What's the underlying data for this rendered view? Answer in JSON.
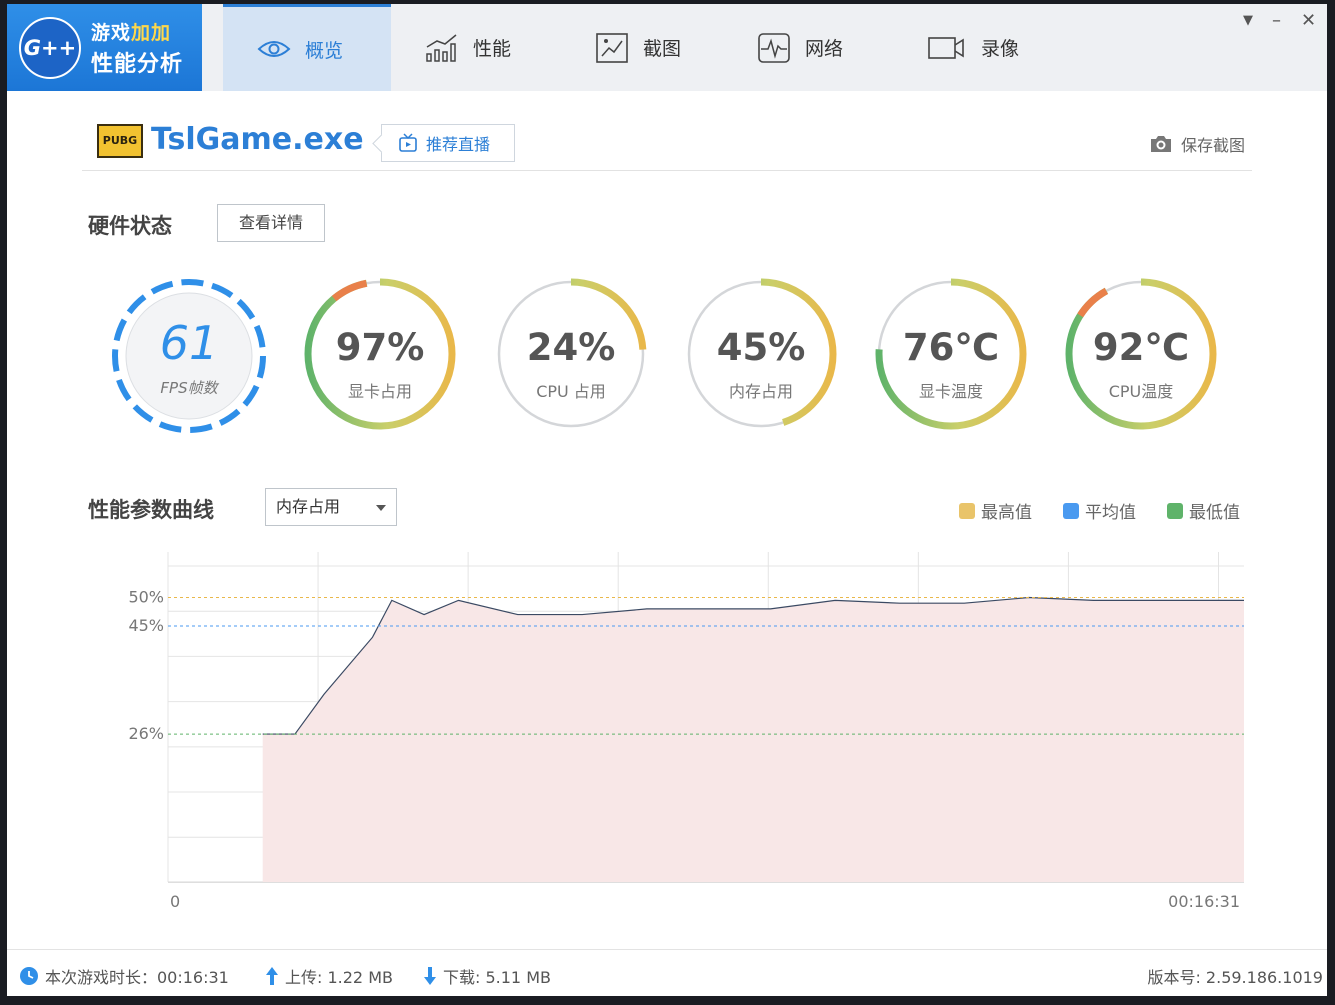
{
  "app": {
    "logo_mark": "G++",
    "logo_line1_a": "游戏",
    "logo_line1_b": "加加",
    "logo_line2": "性能分析"
  },
  "tabs": [
    {
      "label": "概览",
      "icon": "eye-icon",
      "active": true
    },
    {
      "label": "性能",
      "icon": "bar-chart-icon"
    },
    {
      "label": "截图",
      "icon": "image-icon"
    },
    {
      "label": "网络",
      "icon": "pulse-icon"
    },
    {
      "label": "录像",
      "icon": "video-camera-icon"
    }
  ],
  "window_controls": {
    "menu": "▼",
    "minimize": "–",
    "close": "✕"
  },
  "game": {
    "badge": "PUBG",
    "name": "TslGame.exe",
    "live_label": "推荐直播",
    "save_screenshot": "保存截图"
  },
  "hardware": {
    "title": "硬件状态",
    "detail_button": "查看详情",
    "gauges": [
      {
        "value": "61",
        "label": "FPS帧数",
        "type": "fps"
      },
      {
        "value": "97%",
        "label": "显卡占用",
        "fraction": 0.97
      },
      {
        "value": "24%",
        "label": "CPU 占用",
        "fraction": 0.24
      },
      {
        "value": "45%",
        "label": "内存占用",
        "fraction": 0.45
      },
      {
        "value": "76℃",
        "label": "显卡温度",
        "fraction": 0.76
      },
      {
        "value": "92℃",
        "label": "CPU温度",
        "fraction": 0.92
      }
    ]
  },
  "performance": {
    "title": "性能参数曲线",
    "selected_metric": "内存占用",
    "legend": [
      {
        "label": "最高值",
        "color": "#e9c46a"
      },
      {
        "label": "平均值",
        "color": "#4a9af0"
      },
      {
        "label": "最低值",
        "color": "#5fb36a"
      }
    ]
  },
  "chart_data": {
    "type": "area",
    "y_unit": "%",
    "x_start_label": "0",
    "x_end_label": "00:16:31",
    "reference_lines": [
      {
        "label": "50%",
        "value": 50,
        "kind": "max",
        "color": "#e9b84a"
      },
      {
        "label": "45%",
        "value": 45,
        "kind": "avg",
        "color": "#4a9af0"
      },
      {
        "label": "26%",
        "value": 26,
        "kind": "min",
        "color": "#5fb36a"
      }
    ],
    "ylim": [
      0,
      58
    ],
    "x": [
      0.088,
      0.118,
      0.145,
      0.19,
      0.208,
      0.238,
      0.27,
      0.325,
      0.385,
      0.445,
      0.5,
      0.56,
      0.62,
      0.68,
      0.74,
      0.8,
      0.86,
      0.91,
      0.96,
      1.0
    ],
    "values": [
      26,
      26,
      33,
      43,
      49.5,
      47,
      49.5,
      47,
      47,
      48,
      48,
      48,
      49.5,
      49,
      49,
      50,
      49.5,
      49.5,
      49.5,
      49.5
    ],
    "fill_color": "#f8e7e7",
    "line_color": "#3b4a63"
  },
  "footer": {
    "play_time_label": "本次游戏时长：00:16:31",
    "upload_label": "上传: 1.22 MB",
    "download_label": "下载: 5.11 MB",
    "version_label": "版本号:  2.59.186.1019"
  }
}
